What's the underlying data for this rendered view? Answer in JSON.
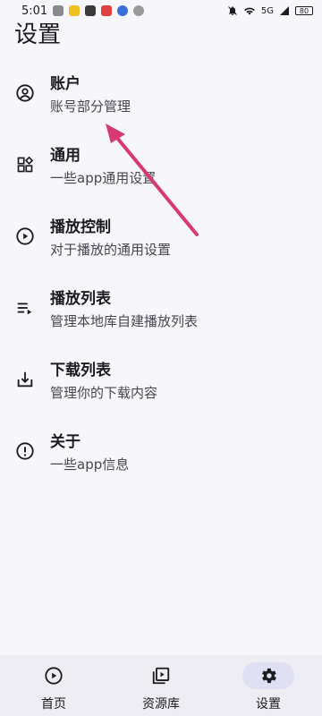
{
  "status_bar": {
    "time": "5:01",
    "network": "5G",
    "battery": "80"
  },
  "page": {
    "title": "设置"
  },
  "settings": [
    {
      "title": "账户",
      "subtitle": "账号部分管理",
      "icon": "account-circle-icon"
    },
    {
      "title": "通用",
      "subtitle": "一些app通用设置",
      "icon": "widgets-icon"
    },
    {
      "title": "播放控制",
      "subtitle": "对于播放的通用设置",
      "icon": "play-circle-icon"
    },
    {
      "title": "播放列表",
      "subtitle": "管理本地库自建播放列表",
      "icon": "playlist-play-icon"
    },
    {
      "title": "下载列表",
      "subtitle": "管理你的下载内容",
      "icon": "download-icon"
    },
    {
      "title": "关于",
      "subtitle": "一些app信息",
      "icon": "info-icon"
    }
  ],
  "bottom_nav": [
    {
      "label": "首页",
      "icon": "play-circle-icon",
      "active": false
    },
    {
      "label": "资源库",
      "icon": "video-library-icon",
      "active": false
    },
    {
      "label": "设置",
      "icon": "gear-icon",
      "active": true
    }
  ],
  "colors": {
    "background": "#f7f6fb",
    "nav_background": "#efedf4",
    "active_indicator": "#dfe0f4",
    "annotation_arrow": "#d63a74"
  }
}
